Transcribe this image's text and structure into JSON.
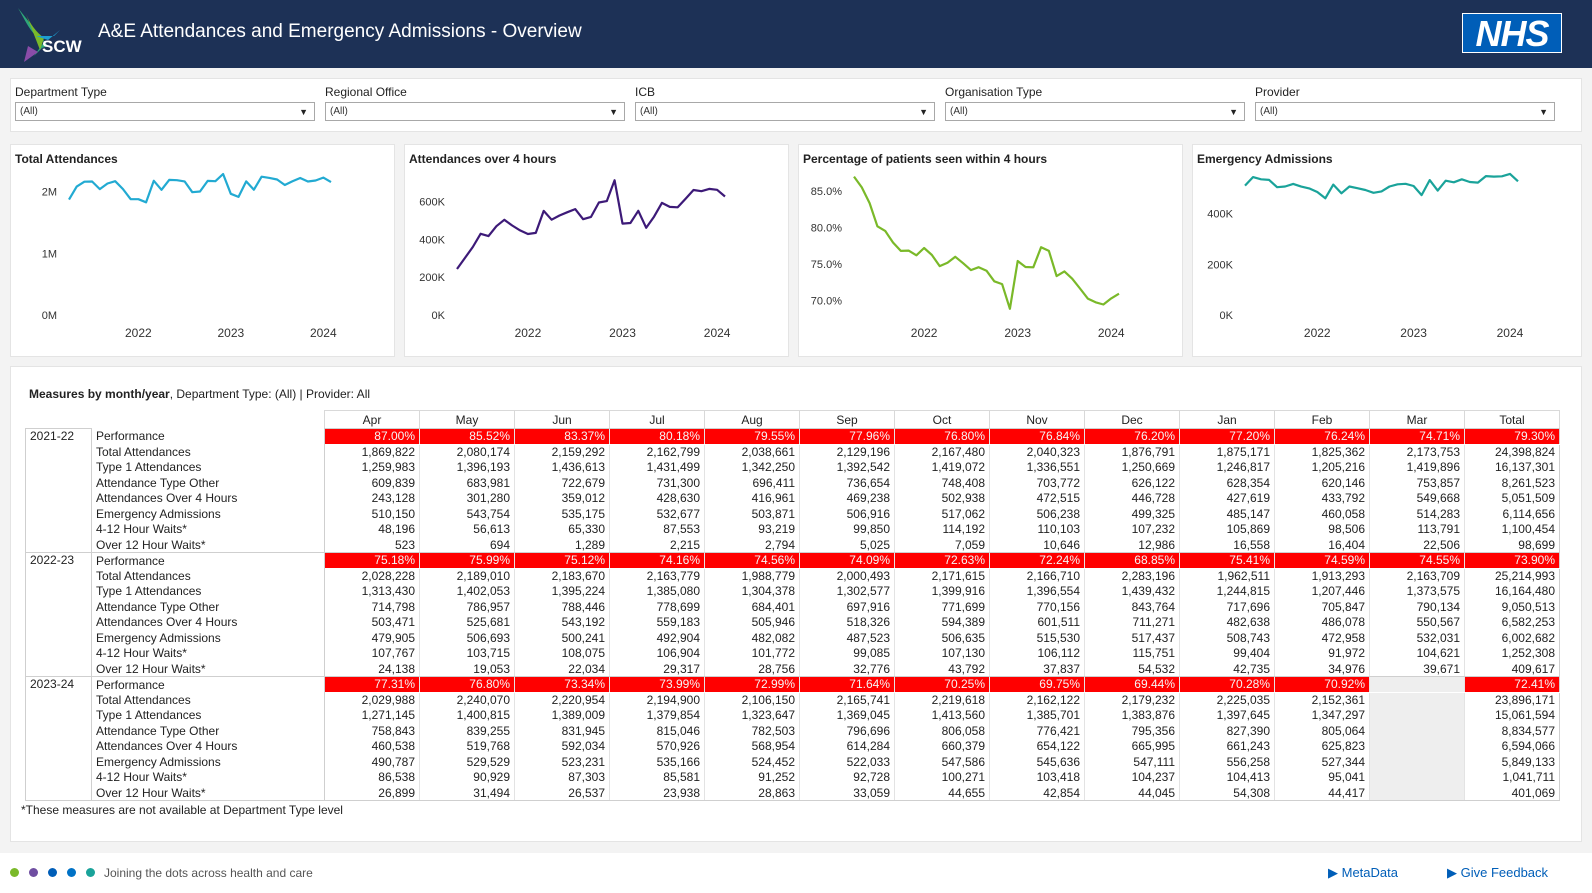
{
  "header": {
    "logo_text": "SCW",
    "title": "A&E Attendances and Emergency Admissions - Overview",
    "nhs_logo": "NHS"
  },
  "filters": [
    {
      "label": "Department Type",
      "value": "(All)"
    },
    {
      "label": "Regional Office",
      "value": "(All)"
    },
    {
      "label": "ICB",
      "value": "(All)"
    },
    {
      "label": "Organisation Type",
      "value": "(All)"
    },
    {
      "label": "Provider",
      "value": "(All)"
    }
  ],
  "colors": {
    "header_bg": "#1d3156",
    "total_attendances": "#22aad2",
    "over_4_hours": "#3d1a78",
    "percentage_4_hours": "#7ab929",
    "emergency_admissions": "#1aa39a",
    "performance_cell": "#ff0000",
    "nhs_blue": "#005eb8"
  },
  "chart_data": [
    {
      "type": "line",
      "title": "Total Attendances",
      "x_ticks": [
        "2022",
        "2023",
        "2024"
      ],
      "y_ticks": [
        "0M",
        "1M",
        "2M"
      ],
      "ylim": [
        0,
        2300000
      ],
      "x_start": "2021-04",
      "series": [
        {
          "values": [
            1869822,
            2080174,
            2159292,
            2162799,
            2038661,
            2129196,
            2167480,
            2040323,
            1876791,
            1875171,
            1825362,
            2173753,
            2028228,
            2189010,
            2183670,
            2163779,
            1988779,
            2000493,
            2171615,
            2166710,
            2283196,
            1962511,
            1913293,
            2163709,
            2029988,
            2240070,
            2220954,
            2194900,
            2106150,
            2165741,
            2219618,
            2162122,
            2179232,
            2225035,
            2152361
          ]
        }
      ]
    },
    {
      "type": "line",
      "title": "Attendances over 4 hours",
      "x_ticks": [
        "2022",
        "2023",
        "2024"
      ],
      "y_ticks": [
        "0K",
        "200K",
        "400K",
        "600K"
      ],
      "ylim": [
        0,
        750000
      ],
      "x_start": "2021-04",
      "series": [
        {
          "values": [
            243128,
            301280,
            359012,
            428630,
            416961,
            469238,
            502938,
            472515,
            446728,
            427619,
            433792,
            549668,
            503471,
            525681,
            543192,
            559183,
            505946,
            518326,
            594389,
            601511,
            711271,
            482638,
            486078,
            550567,
            460538,
            519768,
            592034,
            570926,
            568954,
            614284,
            660379,
            654122,
            665995,
            661243,
            625823
          ]
        }
      ]
    },
    {
      "type": "line",
      "title": "Percentage of patients seen within 4 hours",
      "x_ticks": [
        "2022",
        "2023",
        "2024"
      ],
      "y_ticks": [
        "70.0%",
        "75.0%",
        "80.0%",
        "85.0%"
      ],
      "ylim": [
        68.0,
        87.5
      ],
      "x_start": "2021-04",
      "series": [
        {
          "values": [
            87.0,
            85.52,
            83.37,
            80.18,
            79.55,
            77.96,
            76.8,
            76.84,
            76.2,
            77.2,
            76.24,
            74.71,
            75.18,
            75.99,
            75.12,
            74.16,
            74.56,
            74.09,
            72.63,
            72.24,
            68.85,
            75.41,
            74.59,
            74.55,
            77.31,
            76.8,
            73.34,
            73.99,
            72.99,
            71.64,
            70.25,
            69.75,
            69.44,
            70.28,
            70.92
          ]
        }
      ]
    },
    {
      "type": "line",
      "title": "Emergency Admissions",
      "x_ticks": [
        "2022",
        "2023",
        "2024"
      ],
      "y_ticks": [
        "0K",
        "200K",
        "400K"
      ],
      "ylim": [
        0,
        560000
      ],
      "x_start": "2021-04",
      "series": [
        {
          "values": [
            510150,
            543754,
            535175,
            532677,
            503871,
            506916,
            517062,
            506238,
            499325,
            485147,
            460058,
            514283,
            479905,
            506693,
            500241,
            492904,
            482082,
            487523,
            506635,
            515530,
            517437,
            508743,
            472958,
            532031,
            490787,
            529529,
            523231,
            535166,
            524452,
            522033,
            547586,
            545636,
            547111,
            556258,
            527344
          ]
        }
      ]
    }
  ],
  "table": {
    "title_bold": "Measures by month/year",
    "title_rest": ", Department Type: (All) | Provider: All",
    "columns": [
      "Apr",
      "May",
      "Jun",
      "Jul",
      "Aug",
      "Sep",
      "Oct",
      "Nov",
      "Dec",
      "Jan",
      "Feb",
      "Mar",
      "Total"
    ],
    "groups": [
      {
        "year": "2021-22",
        "rows": [
          {
            "measure": "Performance",
            "values": [
              "87.00%",
              "85.52%",
              "83.37%",
              "80.18%",
              "79.55%",
              "77.96%",
              "76.80%",
              "76.84%",
              "76.20%",
              "77.20%",
              "76.24%",
              "74.71%",
              "79.30%"
            ]
          },
          {
            "measure": "Total Attendances",
            "values": [
              "1,869,822",
              "2,080,174",
              "2,159,292",
              "2,162,799",
              "2,038,661",
              "2,129,196",
              "2,167,480",
              "2,040,323",
              "1,876,791",
              "1,875,171",
              "1,825,362",
              "2,173,753",
              "24,398,824"
            ]
          },
          {
            "measure": "Type 1 Attendances",
            "values": [
              "1,259,983",
              "1,396,193",
              "1,436,613",
              "1,431,499",
              "1,342,250",
              "1,392,542",
              "1,419,072",
              "1,336,551",
              "1,250,669",
              "1,246,817",
              "1,205,216",
              "1,419,896",
              "16,137,301"
            ]
          },
          {
            "measure": "Attendance Type Other",
            "values": [
              "609,839",
              "683,981",
              "722,679",
              "731,300",
              "696,411",
              "736,654",
              "748,408",
              "703,772",
              "626,122",
              "628,354",
              "620,146",
              "753,857",
              "8,261,523"
            ]
          },
          {
            "measure": "Attendances Over 4 Hours",
            "values": [
              "243,128",
              "301,280",
              "359,012",
              "428,630",
              "416,961",
              "469,238",
              "502,938",
              "472,515",
              "446,728",
              "427,619",
              "433,792",
              "549,668",
              "5,051,509"
            ]
          },
          {
            "measure": "Emergency Admissions",
            "values": [
              "510,150",
              "543,754",
              "535,175",
              "532,677",
              "503,871",
              "506,916",
              "517,062",
              "506,238",
              "499,325",
              "485,147",
              "460,058",
              "514,283",
              "6,114,656"
            ]
          },
          {
            "measure": "4-12 Hour Waits*",
            "values": [
              "48,196",
              "56,613",
              "65,330",
              "87,553",
              "93,219",
              "99,850",
              "114,192",
              "110,103",
              "107,232",
              "105,869",
              "98,506",
              "113,791",
              "1,100,454"
            ]
          },
          {
            "measure": "Over 12 Hour Waits*",
            "values": [
              "523",
              "694",
              "1,289",
              "2,215",
              "2,794",
              "5,025",
              "7,059",
              "10,646",
              "12,986",
              "16,558",
              "16,404",
              "22,506",
              "98,699"
            ]
          }
        ]
      },
      {
        "year": "2022-23",
        "rows": [
          {
            "measure": "Performance",
            "values": [
              "75.18%",
              "75.99%",
              "75.12%",
              "74.16%",
              "74.56%",
              "74.09%",
              "72.63%",
              "72.24%",
              "68.85%",
              "75.41%",
              "74.59%",
              "74.55%",
              "73.90%"
            ]
          },
          {
            "measure": "Total Attendances",
            "values": [
              "2,028,228",
              "2,189,010",
              "2,183,670",
              "2,163,779",
              "1,988,779",
              "2,000,493",
              "2,171,615",
              "2,166,710",
              "2,283,196",
              "1,962,511",
              "1,913,293",
              "2,163,709",
              "25,214,993"
            ]
          },
          {
            "measure": "Type 1 Attendances",
            "values": [
              "1,313,430",
              "1,402,053",
              "1,395,224",
              "1,385,080",
              "1,304,378",
              "1,302,577",
              "1,399,916",
              "1,396,554",
              "1,439,432",
              "1,244,815",
              "1,207,446",
              "1,373,575",
              "16,164,480"
            ]
          },
          {
            "measure": "Attendance Type Other",
            "values": [
              "714,798",
              "786,957",
              "788,446",
              "778,699",
              "684,401",
              "697,916",
              "771,699",
              "770,156",
              "843,764",
              "717,696",
              "705,847",
              "790,134",
              "9,050,513"
            ]
          },
          {
            "measure": "Attendances Over 4 Hours",
            "values": [
              "503,471",
              "525,681",
              "543,192",
              "559,183",
              "505,946",
              "518,326",
              "594,389",
              "601,511",
              "711,271",
              "482,638",
              "486,078",
              "550,567",
              "6,582,253"
            ]
          },
          {
            "measure": "Emergency Admissions",
            "values": [
              "479,905",
              "506,693",
              "500,241",
              "492,904",
              "482,082",
              "487,523",
              "506,635",
              "515,530",
              "517,437",
              "508,743",
              "472,958",
              "532,031",
              "6,002,682"
            ]
          },
          {
            "measure": "4-12 Hour Waits*",
            "values": [
              "107,767",
              "103,715",
              "108,075",
              "106,904",
              "101,772",
              "99,085",
              "107,130",
              "106,112",
              "115,751",
              "99,404",
              "91,972",
              "104,621",
              "1,252,308"
            ]
          },
          {
            "measure": "Over 12 Hour Waits*",
            "values": [
              "24,138",
              "19,053",
              "22,034",
              "29,317",
              "28,756",
              "32,776",
              "43,792",
              "37,837",
              "54,532",
              "42,735",
              "34,976",
              "39,671",
              "409,617"
            ]
          }
        ]
      },
      {
        "year": "2023-24",
        "rows": [
          {
            "measure": "Performance",
            "values": [
              "77.31%",
              "76.80%",
              "73.34%",
              "73.99%",
              "72.99%",
              "71.64%",
              "70.25%",
              "69.75%",
              "69.44%",
              "70.28%",
              "70.92%",
              "",
              "72.41%"
            ]
          },
          {
            "measure": "Total Attendances",
            "values": [
              "2,029,988",
              "2,240,070",
              "2,220,954",
              "2,194,900",
              "2,106,150",
              "2,165,741",
              "2,219,618",
              "2,162,122",
              "2,179,232",
              "2,225,035",
              "2,152,361",
              "",
              "23,896,171"
            ]
          },
          {
            "measure": "Type 1 Attendances",
            "values": [
              "1,271,145",
              "1,400,815",
              "1,389,009",
              "1,379,854",
              "1,323,647",
              "1,369,045",
              "1,413,560",
              "1,385,701",
              "1,383,876",
              "1,397,645",
              "1,347,297",
              "",
              "15,061,594"
            ]
          },
          {
            "measure": "Attendance Type Other",
            "values": [
              "758,843",
              "839,255",
              "831,945",
              "815,046",
              "782,503",
              "796,696",
              "806,058",
              "776,421",
              "795,356",
              "827,390",
              "805,064",
              "",
              "8,834,577"
            ]
          },
          {
            "measure": "Attendances Over 4 Hours",
            "values": [
              "460,538",
              "519,768",
              "592,034",
              "570,926",
              "568,954",
              "614,284",
              "660,379",
              "654,122",
              "665,995",
              "661,243",
              "625,823",
              "",
              "6,594,066"
            ]
          },
          {
            "measure": "Emergency Admissions",
            "values": [
              "490,787",
              "529,529",
              "523,231",
              "535,166",
              "524,452",
              "522,033",
              "547,586",
              "545,636",
              "547,111",
              "556,258",
              "527,344",
              "",
              "5,849,133"
            ]
          },
          {
            "measure": "4-12 Hour Waits*",
            "values": [
              "86,538",
              "90,929",
              "87,303",
              "85,581",
              "91,252",
              "92,728",
              "100,271",
              "103,418",
              "104,237",
              "104,413",
              "95,041",
              "",
              "1,041,711"
            ]
          },
          {
            "measure": "Over 12 Hour Waits*",
            "values": [
              "26,899",
              "31,494",
              "26,537",
              "23,938",
              "28,863",
              "33,059",
              "44,655",
              "42,854",
              "44,045",
              "54,308",
              "44,417",
              "",
              "401,069"
            ]
          }
        ]
      }
    ],
    "footnote": "*These measures are not available at Department Type level"
  },
  "footer": {
    "tagline": "Joining the dots across health and care",
    "metadata_link": "MetaData",
    "feedback_link": "Give Feedback",
    "dot_colors": [
      "#7ab929",
      "#6f4ea1",
      "#005eb8",
      "#0072c6",
      "#1aa39a"
    ]
  }
}
